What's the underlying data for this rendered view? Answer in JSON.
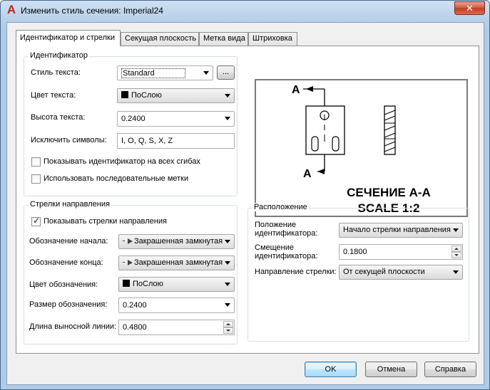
{
  "window": {
    "title": "Изменить стиль сечения: Imperial24",
    "app_icon": "autocad-a-icon",
    "close_glyph": "✕"
  },
  "tabs": [
    {
      "label": "Идентификатор и стрелки",
      "active": true
    },
    {
      "label": "Секущая плоскость",
      "active": false
    },
    {
      "label": "Метка вида",
      "active": false
    },
    {
      "label": "Штриховка",
      "active": false
    }
  ],
  "identifier": {
    "group_title": "Идентификатор",
    "text_style_label": "Стиль текста:",
    "text_style_value": "Standard",
    "text_style_browse": "...",
    "text_color_label": "Цвет текста:",
    "text_color_value": "ПоСлою",
    "text_height_label": "Высота текста:",
    "text_height_value": "0.2400",
    "exclude_label": "Исключить символы:",
    "exclude_value": "I, O, Q, S, X, Z",
    "show_all_bends_label": "Показывать идентификатор на всех сгибах",
    "show_all_bends_checked": false,
    "consecutive_labels_label": "Использовать последовательные метки",
    "consecutive_labels_checked": false
  },
  "arrows": {
    "group_title": "Стрелки направления",
    "show_arrows_label": "Показывать стрелки направления",
    "show_arrows_checked": true,
    "start_symbol_label": "Обозначение начала:",
    "start_symbol_value": "Закрашенная замкнутая",
    "end_symbol_label": "Обозначение конца:",
    "end_symbol_value": "Закрашенная замкнутая",
    "symbol_color_label": "Цвет обозначения:",
    "symbol_color_value": "ПоСлою",
    "symbol_size_label": "Размер обозначения:",
    "symbol_size_value": "0.2400",
    "extension_length_label": "Длина выносной линии:",
    "extension_length_value": "0.4800"
  },
  "location": {
    "group_title": "Расположение",
    "position_label": "Положение идентификатора:",
    "position_value": "Начало стрелки направления",
    "offset_label": "Смещение идентификатора:",
    "offset_value": "0.1800",
    "direction_label": "Направление стрелки:",
    "direction_value": "От секущей плоскости"
  },
  "preview": {
    "label_top": "A",
    "label_bottom": "A",
    "caption_line1": "СЕЧЕНИЕ А-А",
    "caption_line2": "SCALE 1:2"
  },
  "buttons": {
    "ok": "OK",
    "cancel": "Отмена",
    "help": "Справка"
  }
}
